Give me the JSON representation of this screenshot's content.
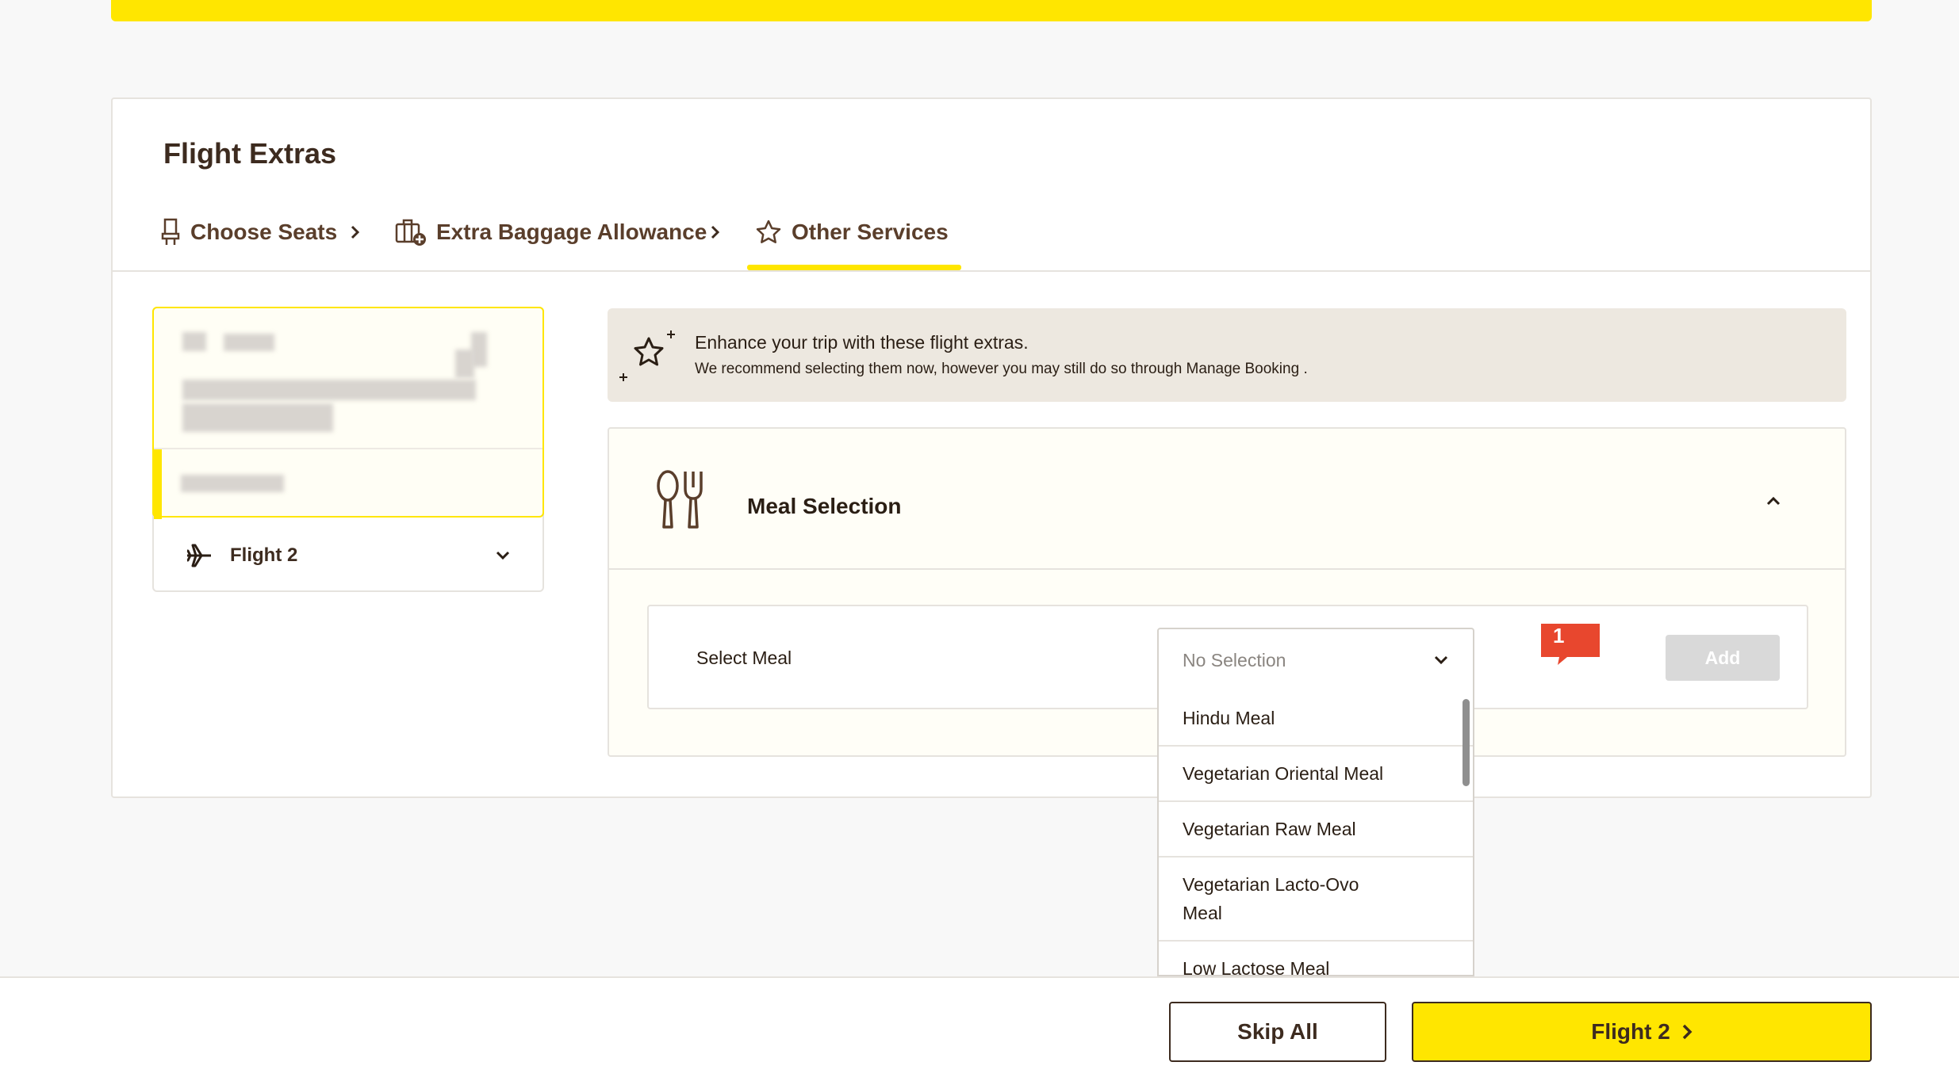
{
  "header": {
    "title": "Flight Extras"
  },
  "steps": [
    {
      "label": "Choose Seats",
      "icon": "seat-icon"
    },
    {
      "label": "Extra Baggage Allowance",
      "icon": "baggage-add-icon"
    },
    {
      "label": "Other Services",
      "icon": "star-icon",
      "active": true
    }
  ],
  "passenger": {
    "flight2_label": "Flight 2"
  },
  "banner": {
    "title": "Enhance your trip with these flight extras.",
    "subtitle": "We recommend selecting them now, however you may still do so through Manage Booking ."
  },
  "meal": {
    "title": "Meal Selection",
    "select_label": "Select Meal",
    "selected_value": "No Selection",
    "add_label": "Add",
    "badge_count": "1",
    "options": [
      "Hindu Meal",
      "Vegetarian Oriental Meal",
      "Vegetarian Raw Meal",
      "Vegetarian Lacto-Ovo Meal",
      "Low Lactose Meal"
    ]
  },
  "footer": {
    "skip_label": "Skip All",
    "next_label": "Flight 2"
  },
  "colors": {
    "accent": "#ffe600",
    "text": "#3d2b1f",
    "badge": "#e8472e"
  }
}
